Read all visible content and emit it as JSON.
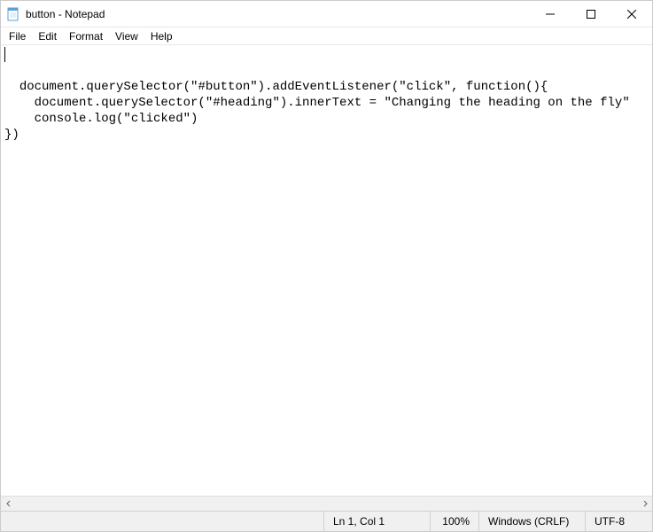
{
  "window": {
    "title": "button - Notepad"
  },
  "menu": {
    "file": "File",
    "edit": "Edit",
    "format": "Format",
    "view": "View",
    "help": "Help"
  },
  "editor": {
    "content": "document.querySelector(\"#button\").addEventListener(\"click\", function(){\n    document.querySelector(\"#heading\").innerText = \"Changing the heading on the fly\"\n    console.log(\"clicked\")\n})"
  },
  "statusbar": {
    "position": "Ln 1, Col 1",
    "zoom": "100%",
    "eol": "Windows (CRLF)",
    "encoding": "UTF-8"
  }
}
